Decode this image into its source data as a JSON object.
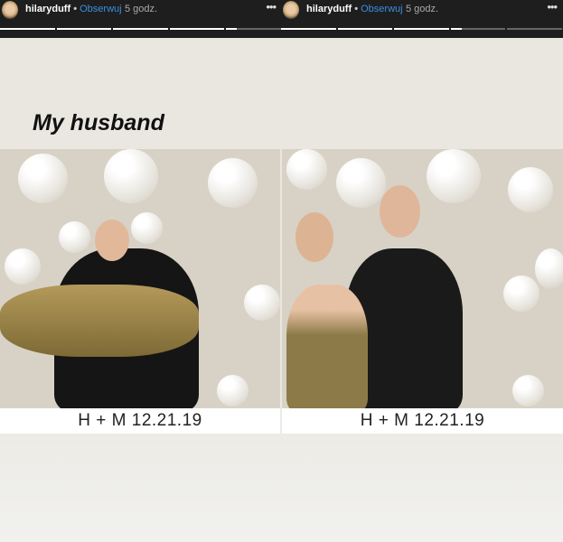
{
  "stories": [
    {
      "username": "hilaryduff",
      "separator": "•",
      "follow_label": "Obserwuj",
      "time": "5 godz.",
      "more": "•••",
      "progress": [
        1,
        1,
        1,
        1,
        0.2
      ]
    },
    {
      "username": "hilaryduff",
      "separator": "•",
      "follow_label": "Obserwuj",
      "time": "5 godz.",
      "more": "•••",
      "progress": [
        1,
        1,
        1,
        0.2,
        0
      ]
    }
  ],
  "post": {
    "title": "My husband",
    "captions": [
      "H + M  12.21.19",
      "H + M  12.21.19"
    ]
  }
}
